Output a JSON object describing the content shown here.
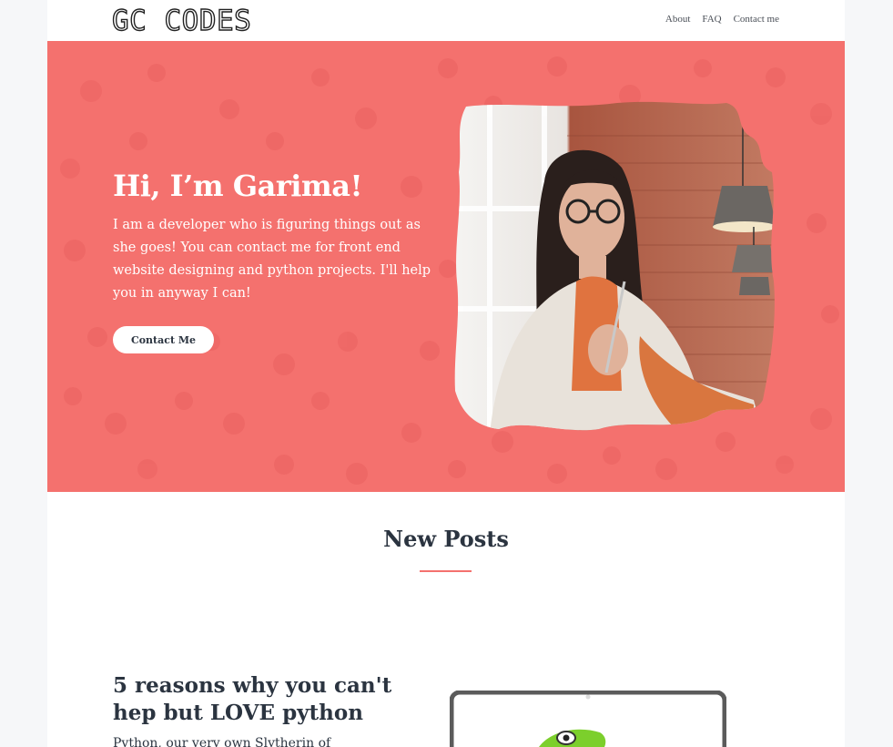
{
  "header": {
    "logo_text": "GC CODES",
    "nav": [
      {
        "label": "About"
      },
      {
        "label": "FAQ"
      },
      {
        "label": "Contact me"
      }
    ]
  },
  "hero": {
    "title": "Hi, I’m Garima!",
    "text": "I am a developer who is figuring things out as she goes! You can contact me for front end website designing and python projects. I'll help you in anyway I can!",
    "button_label": "Contact Me",
    "background_color": "#f4716e"
  },
  "posts_section": {
    "title": "New Posts",
    "accent_color": "#f4716e"
  },
  "posts": [
    {
      "title": "5 reasons why you can't hep but LOVE python",
      "excerpt": "Python, our very own Slytherin of"
    }
  ]
}
